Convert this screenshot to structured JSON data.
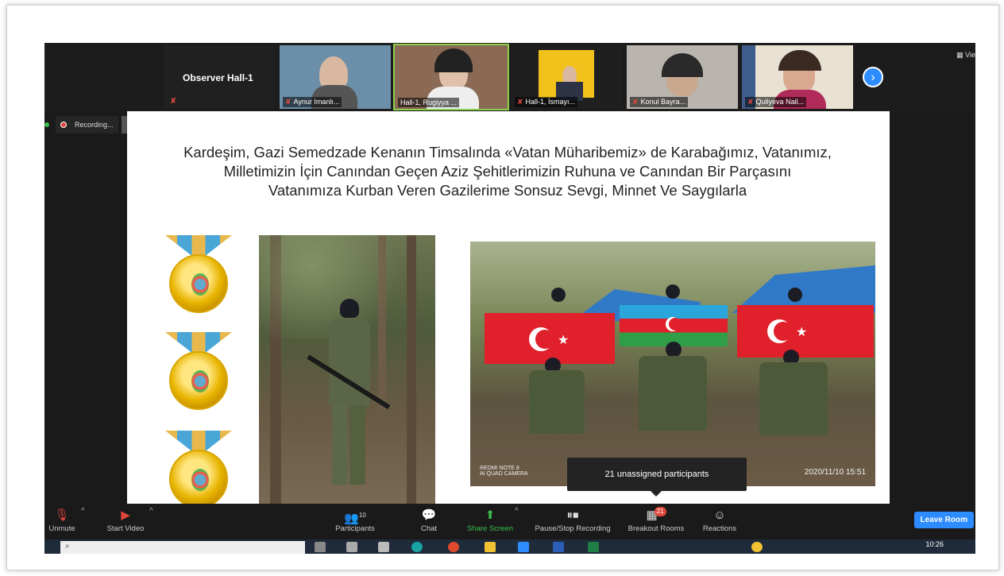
{
  "strip": {
    "observer_title": "Observer Hall-1",
    "participants": [
      {
        "name": "Aynur Imanlı..."
      },
      {
        "name": "Hall-1, Rugiyya ..."
      },
      {
        "name": "Hall-1, İsmayı..."
      },
      {
        "name": "Konul Bayra..."
      },
      {
        "name": "Quliyeva Nail..."
      }
    ],
    "next_icon": "chevron-right-icon",
    "view_label": "Vie"
  },
  "recording": {
    "label": "Recording...",
    "pause_label": "II",
    "stop_label": "■"
  },
  "slide": {
    "title_lines": [
      "Kardeşim, Gazi Semedzade Kenanın Timsalında «Vatan Müharibemiz» de Karabağımız, Vatanımız,",
      "Milletimizin İçin Canından Geçen Aziz Şehitlerimizin Ruhuna ve Canından  Bir Parçasını",
      "Vatanımıza  Kurban Veren  Gazilerime  Sonsuz  Sevgi, Minnet Ve Saygılarla"
    ],
    "photo_caption": "REDMI NOTE 8\nAI QUAD CAMERA",
    "photo_stamp": "2020/11/10  15:51"
  },
  "tooltip": "21 unassigned participants",
  "toolbar": {
    "unmute": "Unmute",
    "start_video": "Start Video",
    "participants": "Participants",
    "participants_count": "10",
    "chat": "Chat",
    "share_screen": "Share Screen",
    "pause_stop": "Pause/Stop Recording",
    "breakout": "Breakout Rooms",
    "breakout_badge": "21",
    "reactions": "Reactions",
    "leave": "Leave Room"
  },
  "taskbar": {
    "search_placeholder": "",
    "clock": "10:26"
  },
  "colors": {
    "accent": "#2d8cff",
    "active_green": "#3bbf4b",
    "alert_red": "#e0473c"
  }
}
